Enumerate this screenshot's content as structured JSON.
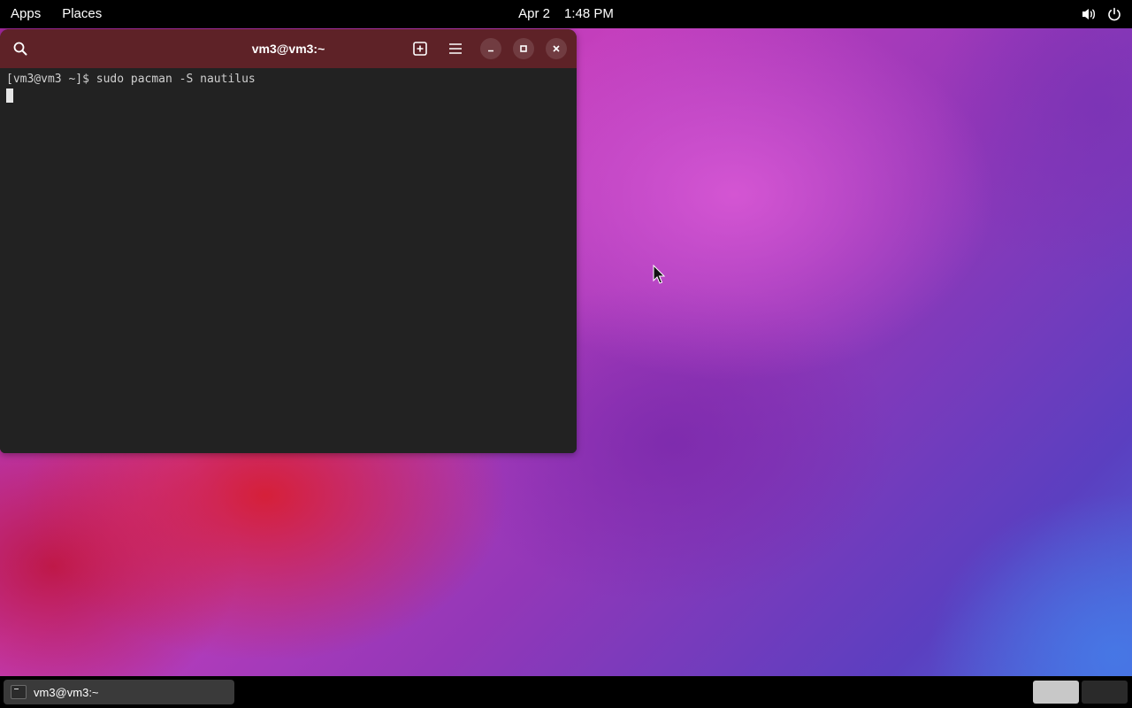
{
  "topbar": {
    "apps_label": "Apps",
    "places_label": "Places",
    "date": "Apr 2",
    "time": "1:48 PM",
    "volume_icon": "speaker-icon",
    "power_icon": "power-icon"
  },
  "terminal": {
    "title": "vm3@vm3:~",
    "buttons": {
      "search_icon": "search-icon",
      "new_tab_icon": "new-tab-icon",
      "menu_icon": "hamburger-menu-icon",
      "minimize_icon": "minimize-icon",
      "maximize_icon": "maximize-icon",
      "close_icon": "close-icon"
    },
    "lines": [
      "[vm3@vm3 ~]$ sudo pacman -S nautilus"
    ],
    "header_color": "#5e2227",
    "background_color": "#222222"
  },
  "taskbar": {
    "window_label": "vm3@vm3:~",
    "workspaces": [
      "workspace-1",
      "workspace-2"
    ],
    "active_workspace": 1
  }
}
